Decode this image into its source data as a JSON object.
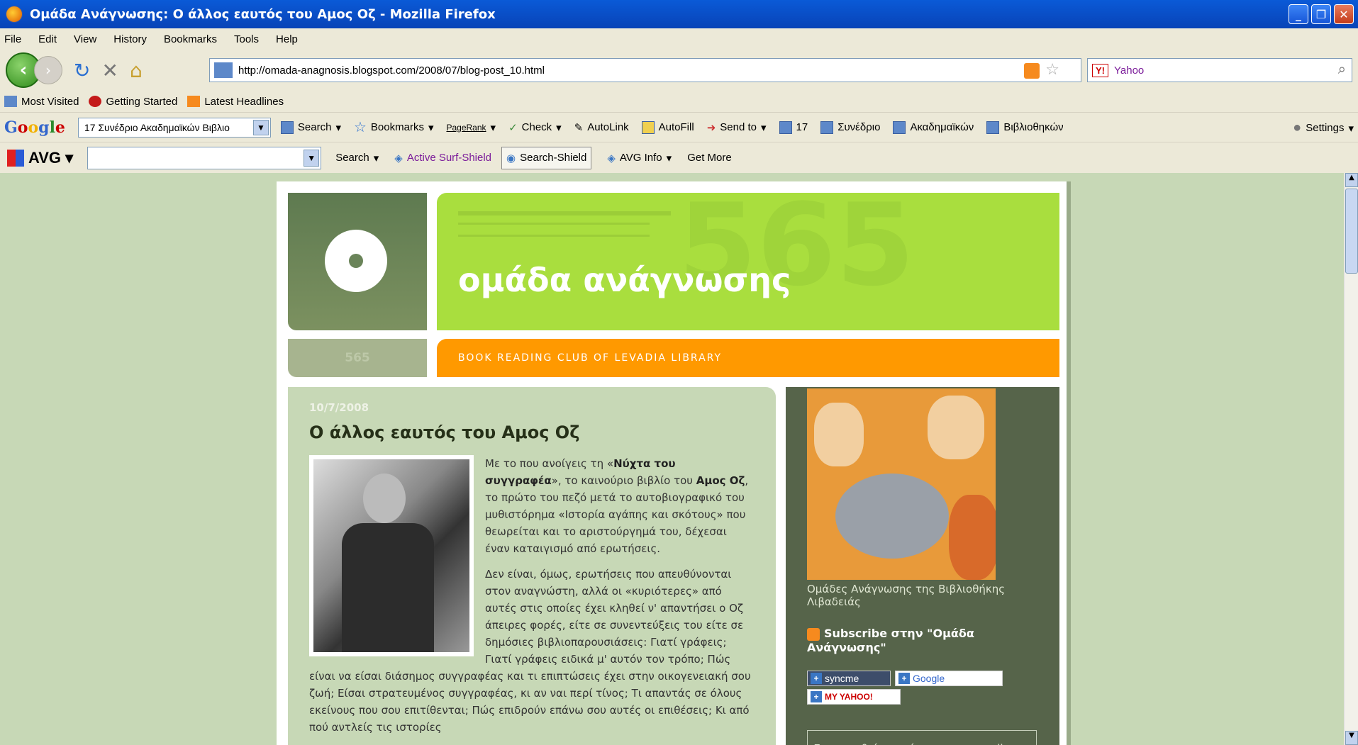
{
  "window": {
    "title": "Ομάδα Ανάγνωσης: Ο άλλος εαυτός του Αμος Οζ - Mozilla Firefox"
  },
  "menu": [
    "File",
    "Edit",
    "View",
    "History",
    "Bookmarks",
    "Tools",
    "Help"
  ],
  "nav": {
    "url": "http://omada-anagnosis.blogspot.com/2008/07/blog-post_10.html",
    "search_engine": "Yahoo",
    "search_placeholder": "Yahoo"
  },
  "bookmarks": [
    "Most Visited",
    "Getting Started",
    "Latest Headlines"
  ],
  "google_toolbar": {
    "logo": "Google",
    "query": "17 Συνέδριο Ακαδημαϊκών Βιβλιο",
    "items": [
      "Search",
      "Bookmarks",
      "PageRank",
      "Check",
      "AutoLink",
      "AutoFill",
      "Send to",
      "17",
      "Συνέδριο",
      "Ακαδημαϊκών",
      "Βιβλιοθηκών"
    ],
    "settings": "Settings"
  },
  "avg_toolbar": {
    "logo": "AVG",
    "search": "Search",
    "active_surf": "Active Surf-Shield",
    "search_shield": "Search-Shield",
    "info": "AVG Info",
    "more": "Get More"
  },
  "blog": {
    "title": "ομάδα ανάγνωσης",
    "subtitle": "BOOK READING CLUB OF LEVADIA LIBRARY",
    "number": "565",
    "post": {
      "date": "10/7/2008",
      "title": "Ο άλλος εαυτός του Αμος Οζ",
      "p1_a": "Με το που ανοίγεις τη «",
      "p1_b": "Νύχτα του συγγραφέα",
      "p1_c": "», το καινούριο βιβλίο του ",
      "p1_d": "Αμος Οζ",
      "p1_e": ", το πρώτο του πεζό μετά το αυτοβιογραφικό του μυθιστόρημα «Ιστορία αγάπης και σκότους» που θεωρείται και το αριστούργημά του, δέχεσαι έναν καταιγισμό από ερωτήσεις.",
      "p2": "Δεν είναι, όμως, ερωτήσεις που απευθύνονται στον αναγνώστη, αλλά οι «κυριότερες» από αυτές στις οποίες έχει κληθεί ν' απαντήσει ο Οζ άπειρες φορές, είτε σε συνεντεύξεις του είτε σε δημόσιες βιβλιοπαρουσιάσεις: Γιατί γράφεις; Γιατί γράφεις ειδικά μ' αυτόν τον τρόπο; Πώς είναι να είσαι διάσημος συγγραφέας και τι επιπτώσεις έχει στην οικογενειακή σου ζωή; Είσαι στρατευμένος συγγραφέας, κι αν ναι περί τίνος; Τι απαντάς σε όλους εκείνους που σου επιτίθενται; Πώς επιδρούν επάνω σου αυτές οι επιθέσεις; Κι από πού αντλείς τις ιστορίες"
    },
    "sidebar": {
      "caption": "Ομάδες Ανάγνωσης της Βιβλιοθήκης Λιβαδειάς",
      "subscribe": "Subscribe στην \"Ομάδα Ανάγνωσης\"",
      "syncme": "syncme",
      "google": "Google",
      "myyahoo": "MY YAHOO!",
      "email_prompt": "Ενημερωθείτε εισάγοντας το email σας:"
    }
  },
  "colors": {
    "page_bg": "#c7d8b6",
    "header_green": "#a9de3e",
    "orange": "#ff9900",
    "sidebar": "#56644a"
  }
}
